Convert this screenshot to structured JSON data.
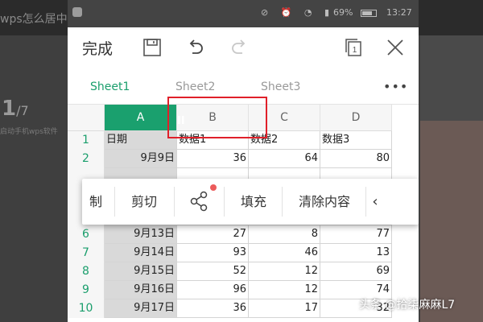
{
  "background": {
    "title_fragment": "wps怎么居中",
    "page_current": "1",
    "page_total": "/7",
    "desc_fragment": "启动手机wps软件"
  },
  "statusbar": {
    "battery": "69%",
    "time": "13:27"
  },
  "toolbar": {
    "done_label": "完成",
    "icons": [
      "save-icon",
      "undo-icon",
      "redo-icon",
      "window-icon",
      "close-icon"
    ],
    "window_count": "1"
  },
  "sheets": {
    "tabs": [
      "Sheet1",
      "Sheet2",
      "Sheet3"
    ],
    "active": "Sheet1",
    "more_label": "•••"
  },
  "grid": {
    "columns": [
      "A",
      "B",
      "C",
      "D"
    ],
    "selected_column": "A",
    "rows": [
      {
        "num": "1",
        "a": "日期",
        "b": "数据1",
        "c": "数据2",
        "d": "数据3"
      },
      {
        "num": "2",
        "a": "9月9日",
        "b": "36",
        "c": "64",
        "d": "80"
      },
      {
        "num": "6",
        "a": "9月13日",
        "b": "27",
        "c": "8",
        "d": "77"
      },
      {
        "num": "7",
        "a": "9月14日",
        "b": "93",
        "c": "46",
        "d": "13"
      },
      {
        "num": "8",
        "a": "9月15日",
        "b": "52",
        "c": "12",
        "d": "69"
      },
      {
        "num": "9",
        "a": "9月16日",
        "b": "96",
        "c": "12",
        "d": "74"
      },
      {
        "num": "10",
        "a": "9月17日",
        "b": "36",
        "c": "17",
        "d": "32"
      }
    ],
    "resize_handle": "II"
  },
  "context_menu": {
    "items": [
      "制",
      "剪切",
      "填充",
      "清除内容"
    ],
    "share_icon": "share-icon",
    "scroll_left_icon": "chevron-left-icon"
  },
  "colors": {
    "accent": "#1aa06e",
    "annotation": "#e0202a"
  },
  "watermark": "头条 @拾柒麻麻L7"
}
